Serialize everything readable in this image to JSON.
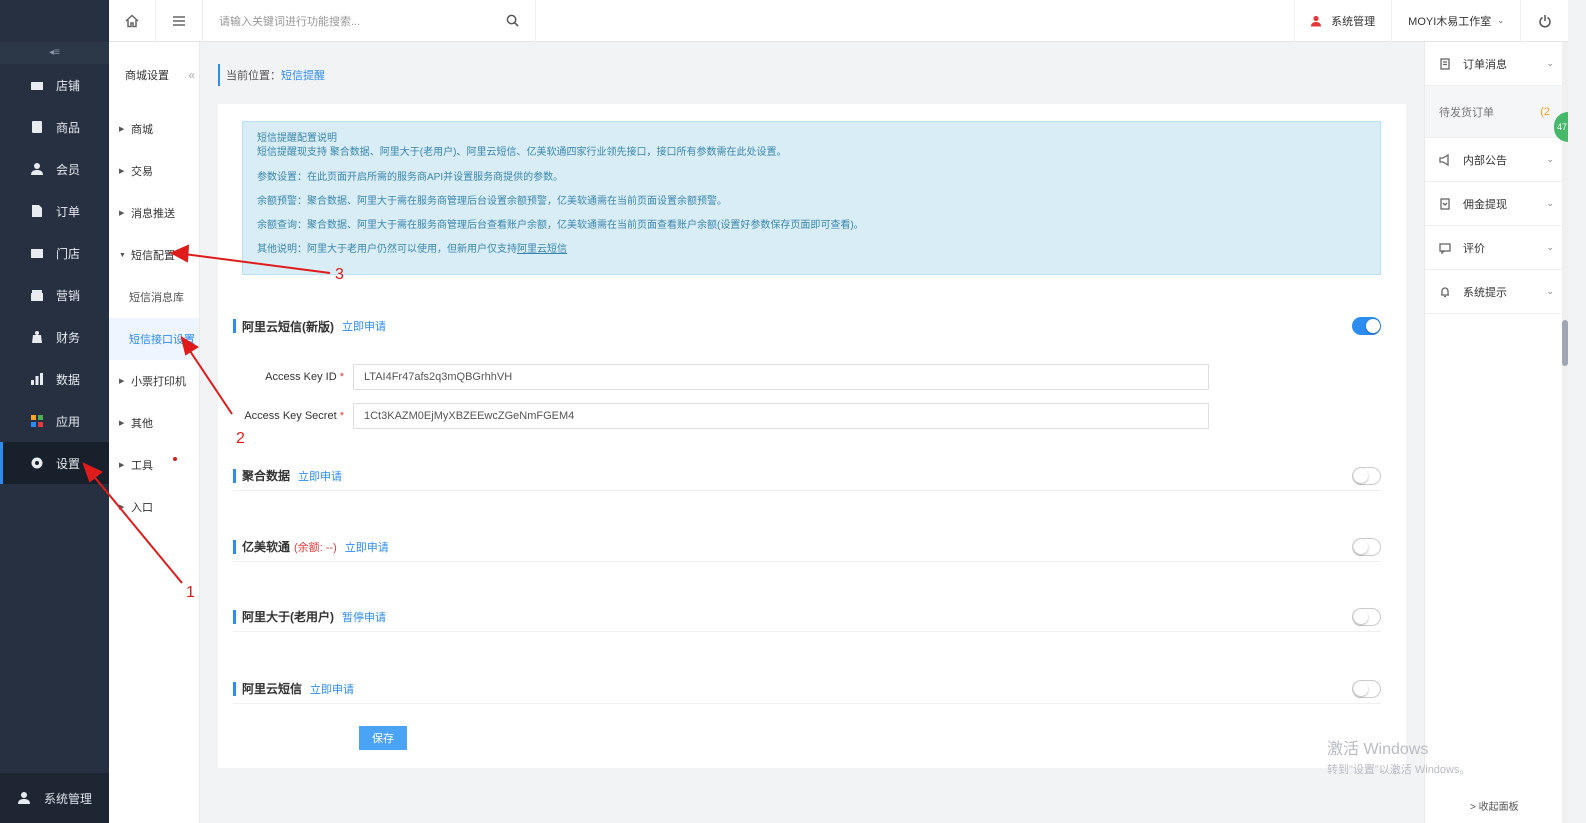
{
  "sidebar": {
    "items": [
      {
        "label": "店铺",
        "icon": "store-icon"
      },
      {
        "label": "商品",
        "icon": "product-icon"
      },
      {
        "label": "会员",
        "icon": "member-icon"
      },
      {
        "label": "订单",
        "icon": "order-icon"
      },
      {
        "label": "门店",
        "icon": "shop-icon"
      },
      {
        "label": "营销",
        "icon": "marketing-icon"
      },
      {
        "label": "财务",
        "icon": "finance-icon"
      },
      {
        "label": "数据",
        "icon": "data-icon"
      },
      {
        "label": "应用",
        "icon": "apps-icon"
      },
      {
        "label": "设置",
        "icon": "gear-icon"
      }
    ],
    "active_label": "设置",
    "bottom_label": "系统管理"
  },
  "header": {
    "search_placeholder": "请输入关键词进行功能搜索...",
    "sys_manage": "系统管理",
    "studio": "MOYI木易工作室"
  },
  "submenu": {
    "title": "商城设置",
    "items": {
      "mall": "商城",
      "trade": "交易",
      "push": "消息推送",
      "sms_config": "短信配置",
      "sms_lib": "短信消息库",
      "sms_interface": "短信接口设置",
      "printer": "小票打印机",
      "other": "其他",
      "tools": "工具",
      "entry": "入口"
    }
  },
  "breadcrumb": {
    "prefix": "当前位置：",
    "current": "短信提醒"
  },
  "info": {
    "title": "短信提醒配置说明",
    "line1": "短信提醒现支持 聚合数据、阿里大于(老用户)、阿里云短信、亿美软通四家行业领先接口，接口所有参数需在此处设置。",
    "line2": "参数设置：在此页面开启所需的服务商API并设置服务商提供的参数。",
    "line3": "余额预警：聚合数据、阿里大于需在服务商管理后台设置余额预警，亿美软通需在当前页面设置余额预警。",
    "line4": "余额查询：聚合数据、阿里大于需在服务商管理后台查看账户余额，亿美软通需在当前页面查看账户余额(设置好参数保存页面即可查看)。",
    "line5_prefix": "其他说明：阿里大于老用户仍然可以使用，但新用户仅支持",
    "line5_link": "阿里云短信"
  },
  "sections": {
    "aliyun_new": {
      "name": "阿里云短信(新版)",
      "apply": "立即申请",
      "enabled": true
    },
    "juhe": {
      "name": "聚合数据",
      "apply": "立即申请",
      "enabled": false
    },
    "yimei": {
      "name": "亿美软通",
      "balance": "(余额: --)",
      "apply": "立即申请",
      "enabled": false
    },
    "alidayu": {
      "name": "阿里大于(老用户)",
      "apply": "暂停申请",
      "enabled": false
    },
    "aliyun": {
      "name": "阿里云短信",
      "apply": "立即申请",
      "enabled": false
    }
  },
  "fields": {
    "key_id_label": "Access Key ID",
    "key_id_value": "LTAI4Fr47afs2q3mQBGrhhVH",
    "key_secret_label": "Access Key Secret",
    "key_secret_value": "1Ct3KAZM0EjMyXBZEEwcZGeNmFGEM4",
    "required_mark": "*"
  },
  "save_label": "保存",
  "right_panel": {
    "order_msg": "订单消息",
    "pending_ship": "待发货订单",
    "pending_count": "(2",
    "notice": "内部公告",
    "commission": "佣金提现",
    "review": "评价",
    "sys_tips": "系统提示",
    "collapse": "> 收起面板"
  },
  "badge_text": "47",
  "watermark": {
    "line1": "激活 Windows",
    "line2": "转到\"设置\"以激活 Windows。"
  },
  "annotations": [
    "1",
    "2",
    "3"
  ],
  "colors": {
    "sidebar_bg": "#263040",
    "accent": "#2d8cf0",
    "annotation_red": "#e01b1b",
    "info_bg": "#d9edf7"
  }
}
